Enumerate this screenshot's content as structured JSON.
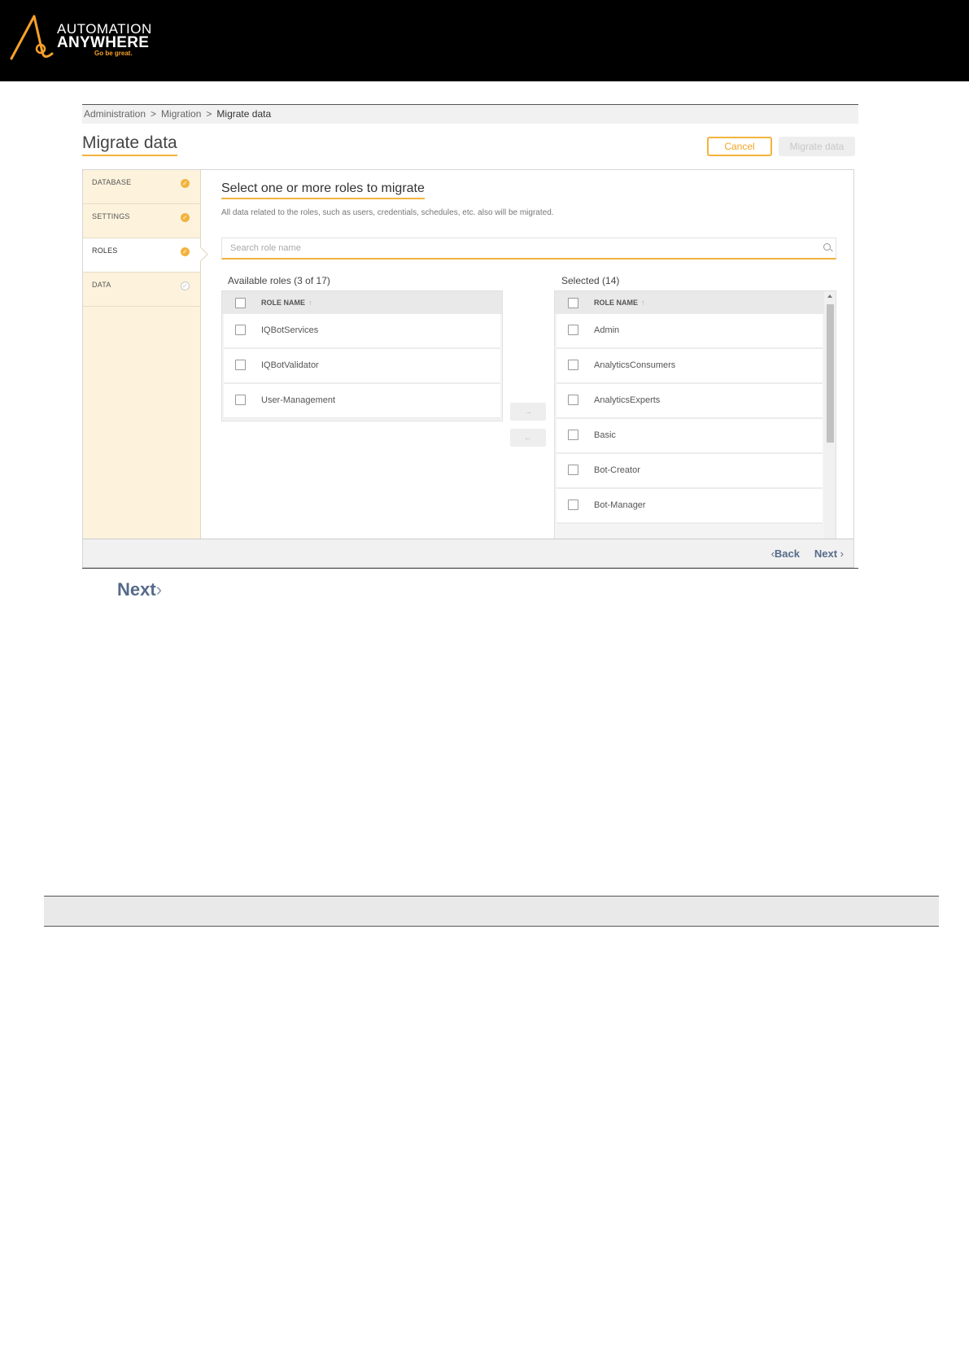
{
  "brand": {
    "line1": "AUTOMATION",
    "line2": "ANYWHERE",
    "tagline": "Go be great.",
    "accent_color": "#f2b33d"
  },
  "breadcrumb": [
    "Administration",
    "Migration",
    "Migrate data"
  ],
  "breadcrumb_separator": ">",
  "page_title": "Migrate data",
  "actions": {
    "cancel_label": "Cancel",
    "migrate_label": "Migrate data"
  },
  "steps": [
    {
      "label": "DATABASE",
      "status": "complete"
    },
    {
      "label": "SETTINGS",
      "status": "complete"
    },
    {
      "label": "ROLES",
      "status": "complete",
      "active": true
    },
    {
      "label": "DATA",
      "status": "pending"
    }
  ],
  "roles_step": {
    "title": "Select one or more roles to migrate",
    "description": "All data related to the roles, such as users, credentials, schedules, etc. also will be migrated.",
    "search_placeholder": "Search role name",
    "available_label": "Available roles",
    "available_count": "(3 of 17)",
    "selected_label": "Selected",
    "selected_count": "(14)",
    "column_header": "ROLE NAME",
    "sort_indicator": "↑",
    "available_roles": [
      "IQBotServices",
      "IQBotValidator",
      "User-Management"
    ],
    "selected_roles": [
      "Admin",
      "AnalyticsConsumers",
      "AnalyticsExperts",
      "Basic",
      "Bot-Creator",
      "Bot-Manager"
    ],
    "move_right_label": "→",
    "move_left_label": "←"
  },
  "footer": {
    "back_label": "Back",
    "next_label": "Next"
  },
  "standalone_next_label": "Next"
}
